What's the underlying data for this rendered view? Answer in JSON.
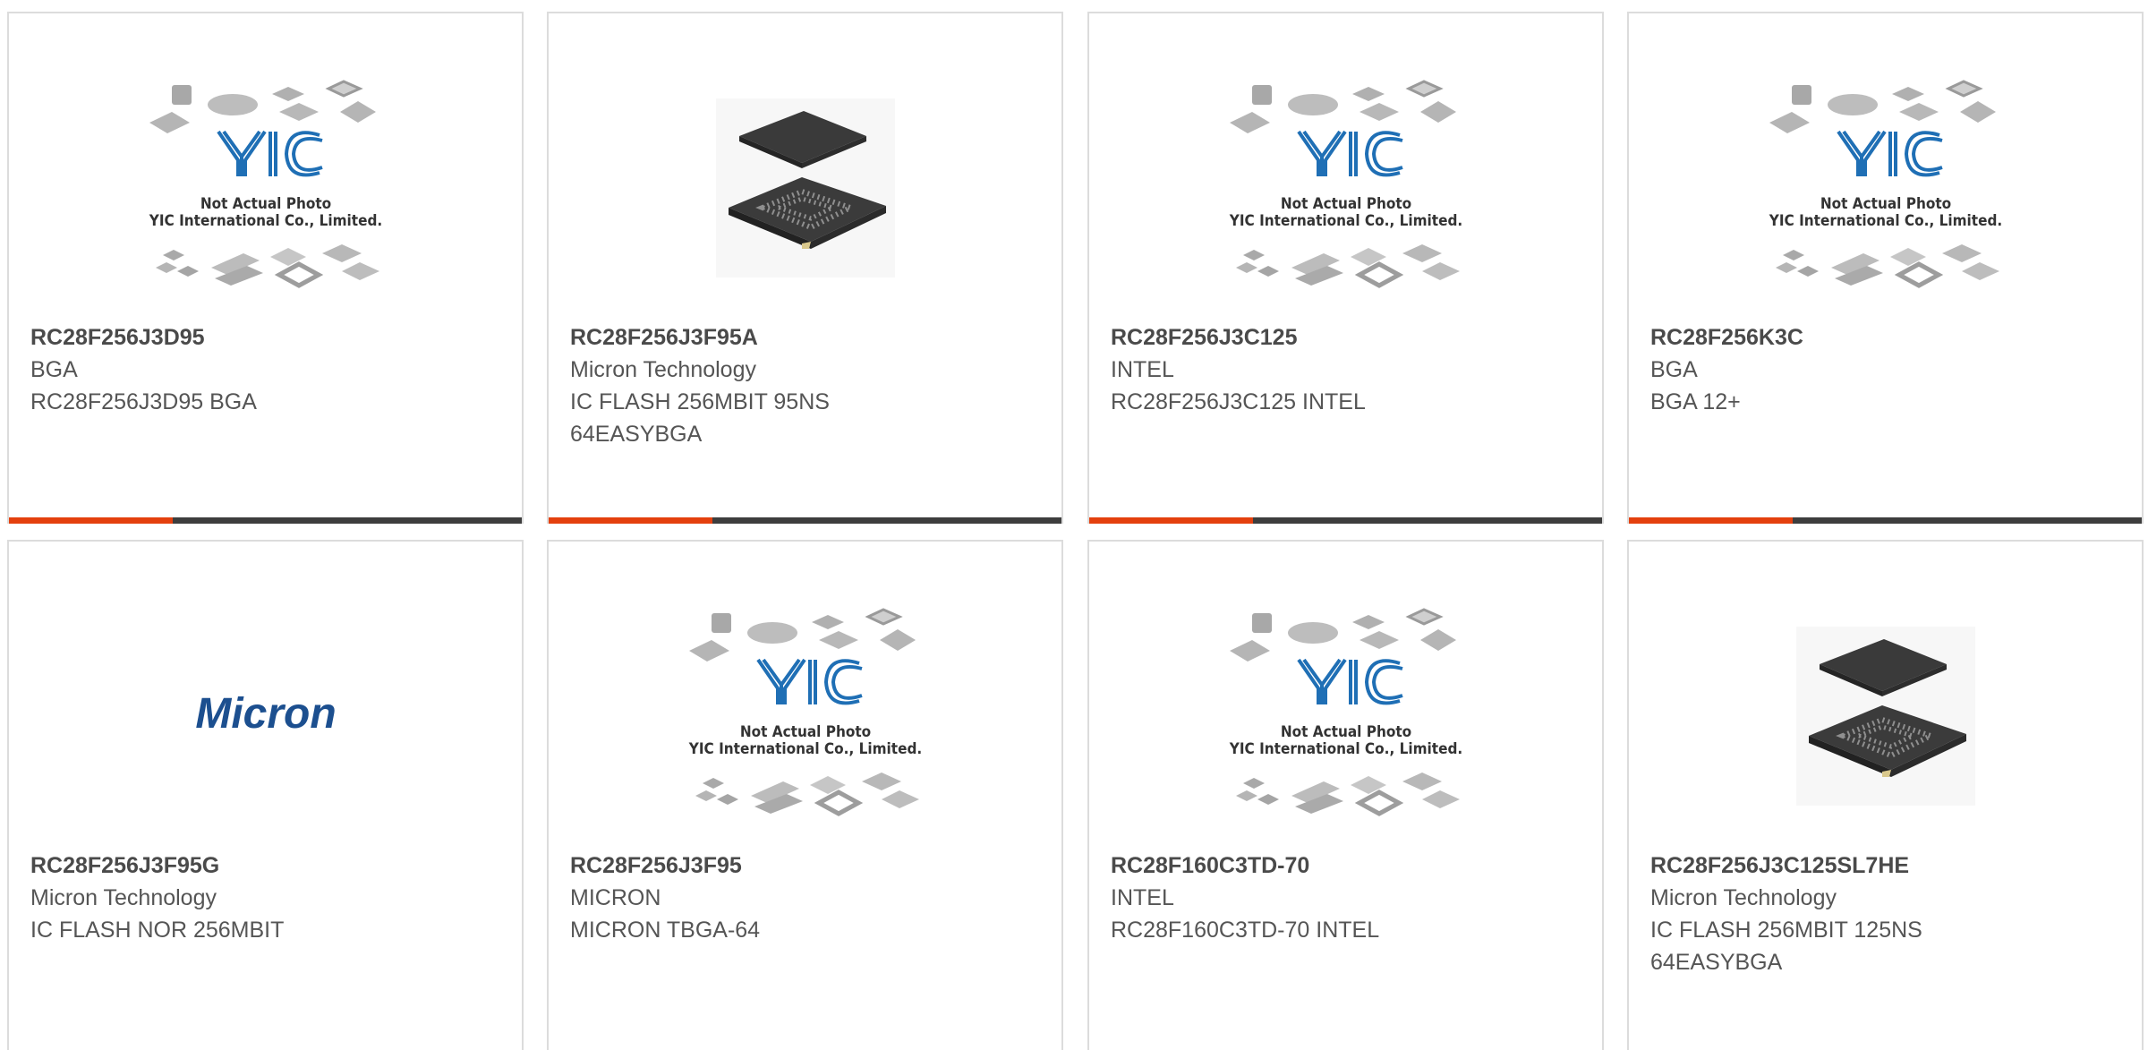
{
  "colors": {
    "accent": "#e4400e",
    "bar": "#3d3d3d",
    "border": "#dcdcdc",
    "text": "#555555"
  },
  "placeholder": {
    "line1": "Not Actual Photo",
    "line2": "YIC International Co., Limited.",
    "logo": "YIC"
  },
  "micron_logo": "Micron",
  "products": [
    {
      "part": "RC28F256J3D95",
      "manufacturer": "BGA",
      "description": "RC28F256J3D95 BGA",
      "image": "yic-placeholder",
      "progress_bar": true
    },
    {
      "part": "RC28F256J3F95A",
      "manufacturer": "Micron Technology",
      "description": "IC FLASH 256MBIT 95NS 64EASYBGA",
      "image": "bga-chip",
      "progress_bar": true
    },
    {
      "part": "RC28F256J3C125",
      "manufacturer": "INTEL",
      "description": "RC28F256J3C125 INTEL",
      "image": "yic-placeholder",
      "progress_bar": true
    },
    {
      "part": "RC28F256K3C",
      "manufacturer": "BGA",
      "description": "BGA 12+",
      "image": "yic-placeholder",
      "progress_bar": true
    },
    {
      "part": "RC28F256J3F95G",
      "manufacturer": "Micron Technology",
      "description": "IC FLASH NOR 256MBIT",
      "image": "micron-logo",
      "progress_bar": false
    },
    {
      "part": "RC28F256J3F95",
      "manufacturer": "MICRON",
      "description": "MICRON TBGA-64",
      "image": "yic-placeholder",
      "progress_bar": false
    },
    {
      "part": "RC28F160C3TD-70",
      "manufacturer": "INTEL",
      "description": "RC28F160C3TD-70 INTEL",
      "image": "yic-placeholder",
      "progress_bar": false
    },
    {
      "part": "RC28F256J3C125SL7HE",
      "manufacturer": "Micron Technology",
      "description": "IC FLASH 256MBIT 125NS 64EASYBGA",
      "image": "bga-chip",
      "progress_bar": false
    }
  ]
}
